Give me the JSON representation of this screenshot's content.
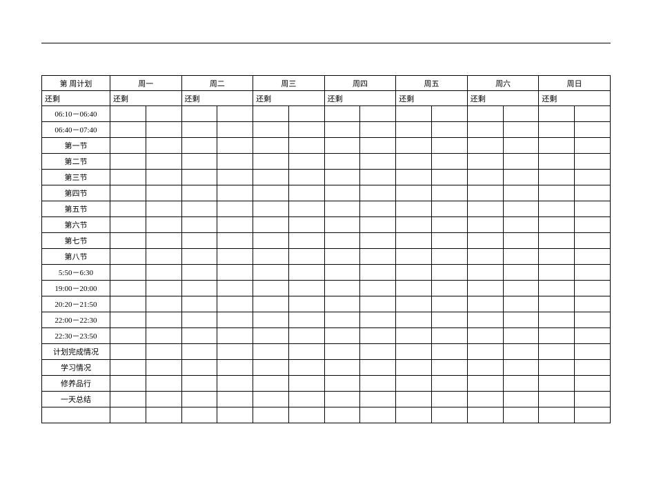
{
  "header": {
    "plan_label": "第    周计划",
    "days": [
      "周一",
      "周二",
      "周三",
      "周四",
      "周五",
      "周六",
      "周日"
    ]
  },
  "remain_row": {
    "label": "还剩",
    "cells": [
      "还剩",
      "还剩",
      "还剩",
      "还剩",
      "还剩",
      "还剩",
      "还剩"
    ]
  },
  "rows": [
    "06:10－06:40",
    "06:40－07:40",
    "第一节",
    "第二节",
    "第三节",
    "第四节",
    "第五节",
    "第六节",
    "第七节",
    "第八节",
    "5:50－6:30",
    "19:00－20:00",
    "20:20－21:50",
    "22:00－22:30",
    "22:30－23:50",
    "计划完成情况",
    "学习情况",
    "修养品行",
    "一天总结",
    ""
  ]
}
